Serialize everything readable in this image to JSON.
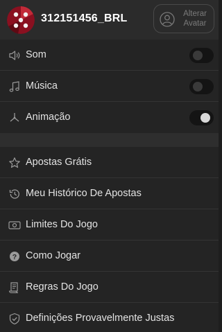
{
  "header": {
    "username": "312151456_BRL",
    "change_avatar_label": "Alterar Avatar"
  },
  "settings": [
    {
      "label": "Som",
      "icon": "speaker-icon",
      "enabled": false
    },
    {
      "label": "Música",
      "icon": "music-note-icon",
      "enabled": false
    },
    {
      "label": "Animação",
      "icon": "animation-icon",
      "enabled": true
    }
  ],
  "menu": [
    {
      "label": "Apostas Grátis",
      "icon": "star-icon"
    },
    {
      "label": "Meu Histórico De Apostas",
      "icon": "history-icon"
    },
    {
      "label": "Limites Do Jogo",
      "icon": "money-icon"
    },
    {
      "label": "Como Jogar",
      "icon": "question-icon"
    },
    {
      "label": "Regras Do Jogo",
      "icon": "document-icon"
    },
    {
      "label": "Definições Provavelmente Justas",
      "icon": "shield-icon"
    }
  ]
}
